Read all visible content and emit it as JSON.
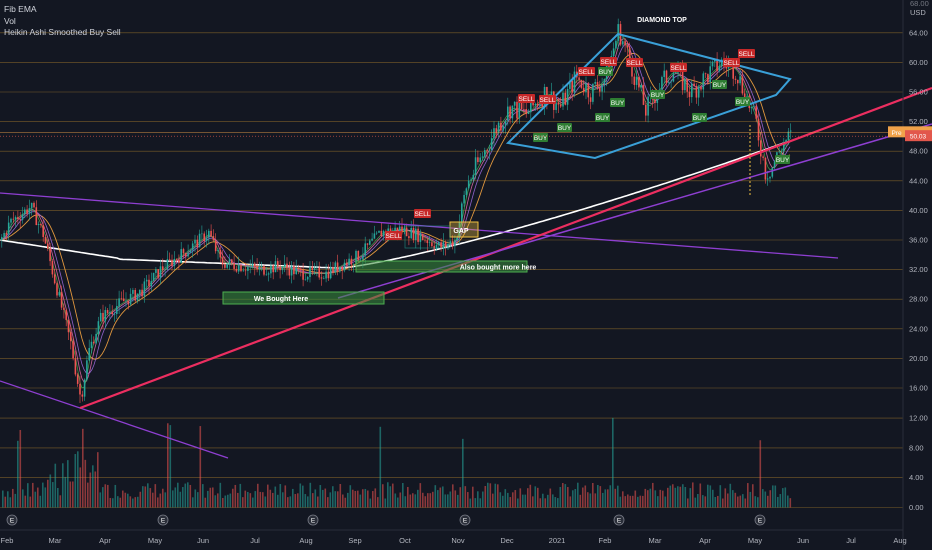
{
  "legend": {
    "line1": "Fib EMA",
    "line2": "Vol",
    "line3": "Heikin Ashi Smoothed Buy Sell"
  },
  "axis": {
    "currency": "USD",
    "top_cut_label": "68.00"
  },
  "price_tags": {
    "pre_label": "Pre",
    "pre_value": "50.55",
    "last_value": "50.03",
    "pre_color": "#f0a24a",
    "last_color": "#e2574c"
  },
  "annotations": {
    "diamond_top": "DIAMOND TOP",
    "gap": "GAP",
    "we_bought_here": "We Bought Here",
    "also_bought_more": "Also bought more here"
  },
  "signal_labels": {
    "buy": "BUY",
    "sell": "SELL"
  },
  "earnings_marker": "E",
  "colors": {
    "background": "#131722",
    "grid": "#8c6a2a",
    "up": "#26a69a",
    "down": "#ef5350",
    "sma200": "#ffffff",
    "trend_pink": "#ec2e60",
    "trend_purple": "#8e3fd1",
    "diamond": "#3aa0d8",
    "buy_tag": "#2e7d32",
    "sell_tag": "#c62828"
  },
  "chart_data": {
    "type": "candlestick",
    "timeframe": "daily",
    "x_axis_labels": [
      "Feb",
      "Mar",
      "Apr",
      "May",
      "Jun",
      "Jul",
      "Aug",
      "Sep",
      "Oct",
      "Nov",
      "Dec",
      "2021",
      "Feb",
      "Mar",
      "Apr",
      "May",
      "Jun",
      "Jul",
      "Aug"
    ],
    "y_axis_price_ticks": [
      "64.00",
      "60.00",
      "56.00",
      "52.00",
      "48.00",
      "44.00",
      "40.00",
      "36.00",
      "32.00",
      "28.00",
      "24.00",
      "20.00",
      "16.00"
    ],
    "y_axis_volume_ticks": [
      "12.00",
      "8.00",
      "4.00",
      "0.00"
    ],
    "ylim_price": [
      13.0,
      65.0
    ],
    "price_path_monthly": [
      {
        "month": "Feb 2020",
        "close": 38.5
      },
      {
        "month": "Mar 2020",
        "close": 19.0
      },
      {
        "month": "Apr 2020",
        "close": 27.5
      },
      {
        "month": "May 2020",
        "close": 33.0
      },
      {
        "month": "Jun 2020",
        "close": 35.5
      },
      {
        "month": "Jul 2020",
        "close": 32.0
      },
      {
        "month": "Aug 2020",
        "close": 32.2
      },
      {
        "month": "Sep 2020",
        "close": 34.0
      },
      {
        "month": "Oct 2020",
        "close": 36.0
      },
      {
        "month": "Nov 2020",
        "close": 46.0
      },
      {
        "month": "Dec 2020",
        "close": 51.5
      },
      {
        "month": "Jan 2021",
        "close": 54.5
      },
      {
        "month": "Feb 2021",
        "close": 60.0
      },
      {
        "month": "Mar 2021",
        "close": 54.0
      },
      {
        "month": "Apr 2021",
        "close": 57.5
      },
      {
        "month": "May 2021",
        "close": 46.0
      },
      {
        "month": "late May 2021",
        "close": 50.03
      }
    ],
    "extremes": {
      "low": 13.8,
      "low_month": "Mar 2020",
      "high": 64.5,
      "high_month": "Feb 2021"
    },
    "last_price": 50.03,
    "pre_market_price": 50.55,
    "series": [
      {
        "name": "Fib EMA",
        "note": "ribbon of short EMAs"
      },
      {
        "name": "Vol"
      },
      {
        "name": "Heikin Ashi Smoothed Buy Sell"
      }
    ],
    "patterns": [
      "DIAMOND TOP",
      "GAP"
    ],
    "grid": true
  }
}
